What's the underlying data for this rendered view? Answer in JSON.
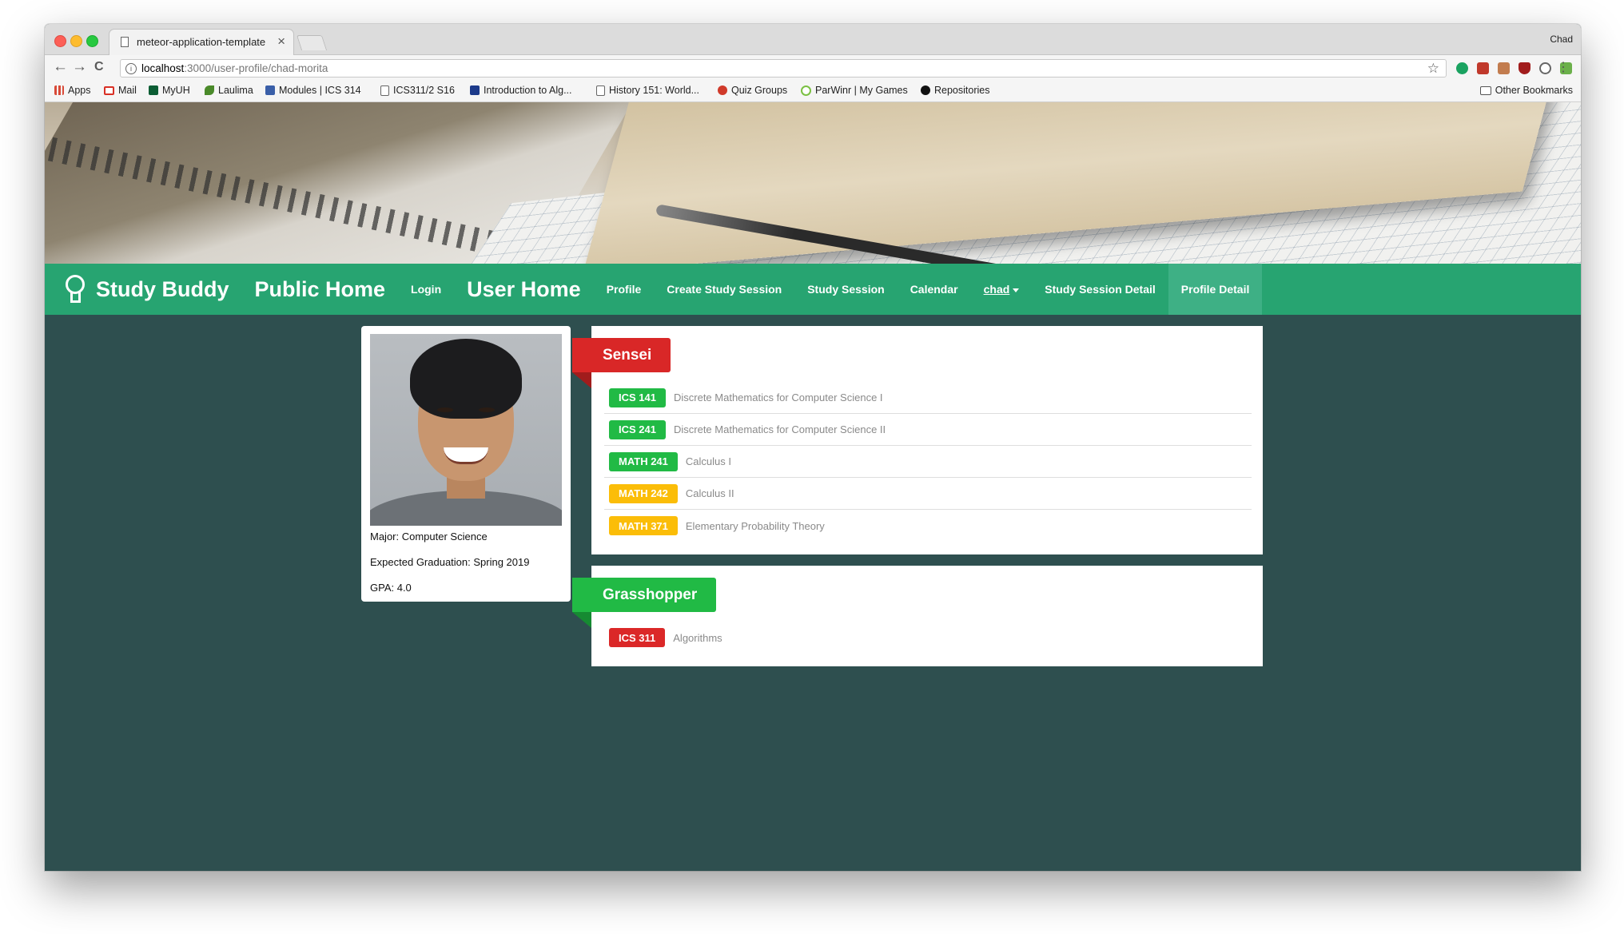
{
  "browser": {
    "tab_title": "meteor-application-template",
    "tab_close": "×",
    "profile_name": "Chad",
    "url_host": "localhost",
    "url_rest": ":3000/user-profile/chad-morita",
    "back": "←",
    "forward": "→",
    "reload": "C",
    "star": "☆",
    "menu": "⋮",
    "bookmarks": [
      {
        "label": "Apps",
        "icon": "apps-grid-icon",
        "color": "#d84a38"
      },
      {
        "label": "Mail",
        "icon": "gmail-icon",
        "color": "#d93025"
      },
      {
        "label": "MyUH",
        "icon": "uh-icon",
        "color": "#0b5d34"
      },
      {
        "label": "Laulima",
        "icon": "laulima-icon",
        "color": "#4a8a2a"
      },
      {
        "label": "Modules | ICS 314",
        "icon": "module-icon",
        "color": "#3a5fa8"
      },
      {
        "label": "ICS311/2 S16",
        "icon": "doc-icon",
        "color": "#ffffff"
      },
      {
        "label": "Introduction to Alg...",
        "icon": "alg-icon",
        "color": "#1c3a8a"
      },
      {
        "label": "History 151: World...",
        "icon": "doc-icon",
        "color": "#ffffff"
      },
      {
        "label": "Quiz Groups",
        "icon": "quiz-icon",
        "color": "#d03a2a"
      },
      {
        "label": "ParWinr | My Games",
        "icon": "parwinr-icon",
        "color": "#7bc043"
      },
      {
        "label": "Repositories",
        "icon": "github-icon",
        "color": "#111111"
      }
    ],
    "other_bookmarks": "Other Bookmarks"
  },
  "navbar": {
    "brand": "Study Buddy",
    "items": [
      {
        "label": "Public Home",
        "size": "big"
      },
      {
        "label": "Login",
        "size": "small"
      },
      {
        "label": "User Home",
        "size": "big"
      },
      {
        "label": "Profile",
        "size": "small"
      },
      {
        "label": "Create Study Session",
        "size": "small"
      },
      {
        "label": "Study Session",
        "size": "small"
      },
      {
        "label": "Calendar",
        "size": "small"
      }
    ],
    "user_dropdown": "chad",
    "after_items": [
      {
        "label": "Study Session Detail"
      },
      {
        "label": "Profile Detail",
        "active": true
      }
    ],
    "color": "#27a471"
  },
  "profile": {
    "major": "Major: Computer Science",
    "graduation": "Expected Graduation: Spring 2019",
    "gpa": "GPA: 4.0"
  },
  "sensei": {
    "title": "Sensei",
    "courses": [
      {
        "code": "ICS 141",
        "name": "Discrete Mathematics for Computer Science I",
        "color": "#21ba45"
      },
      {
        "code": "ICS 241",
        "name": "Discrete Mathematics for Computer Science II",
        "color": "#21ba45"
      },
      {
        "code": "MATH 241",
        "name": "Calculus I",
        "color": "#21ba45"
      },
      {
        "code": "MATH 242",
        "name": "Calculus II",
        "color": "#fbbd08"
      },
      {
        "code": "MATH 371",
        "name": "Elementary Probability Theory",
        "color": "#fbbd08"
      }
    ]
  },
  "grasshopper": {
    "title": "Grasshopper",
    "courses": [
      {
        "code": "ICS 311",
        "name": "Algorithms",
        "color": "#db2828"
      }
    ]
  }
}
